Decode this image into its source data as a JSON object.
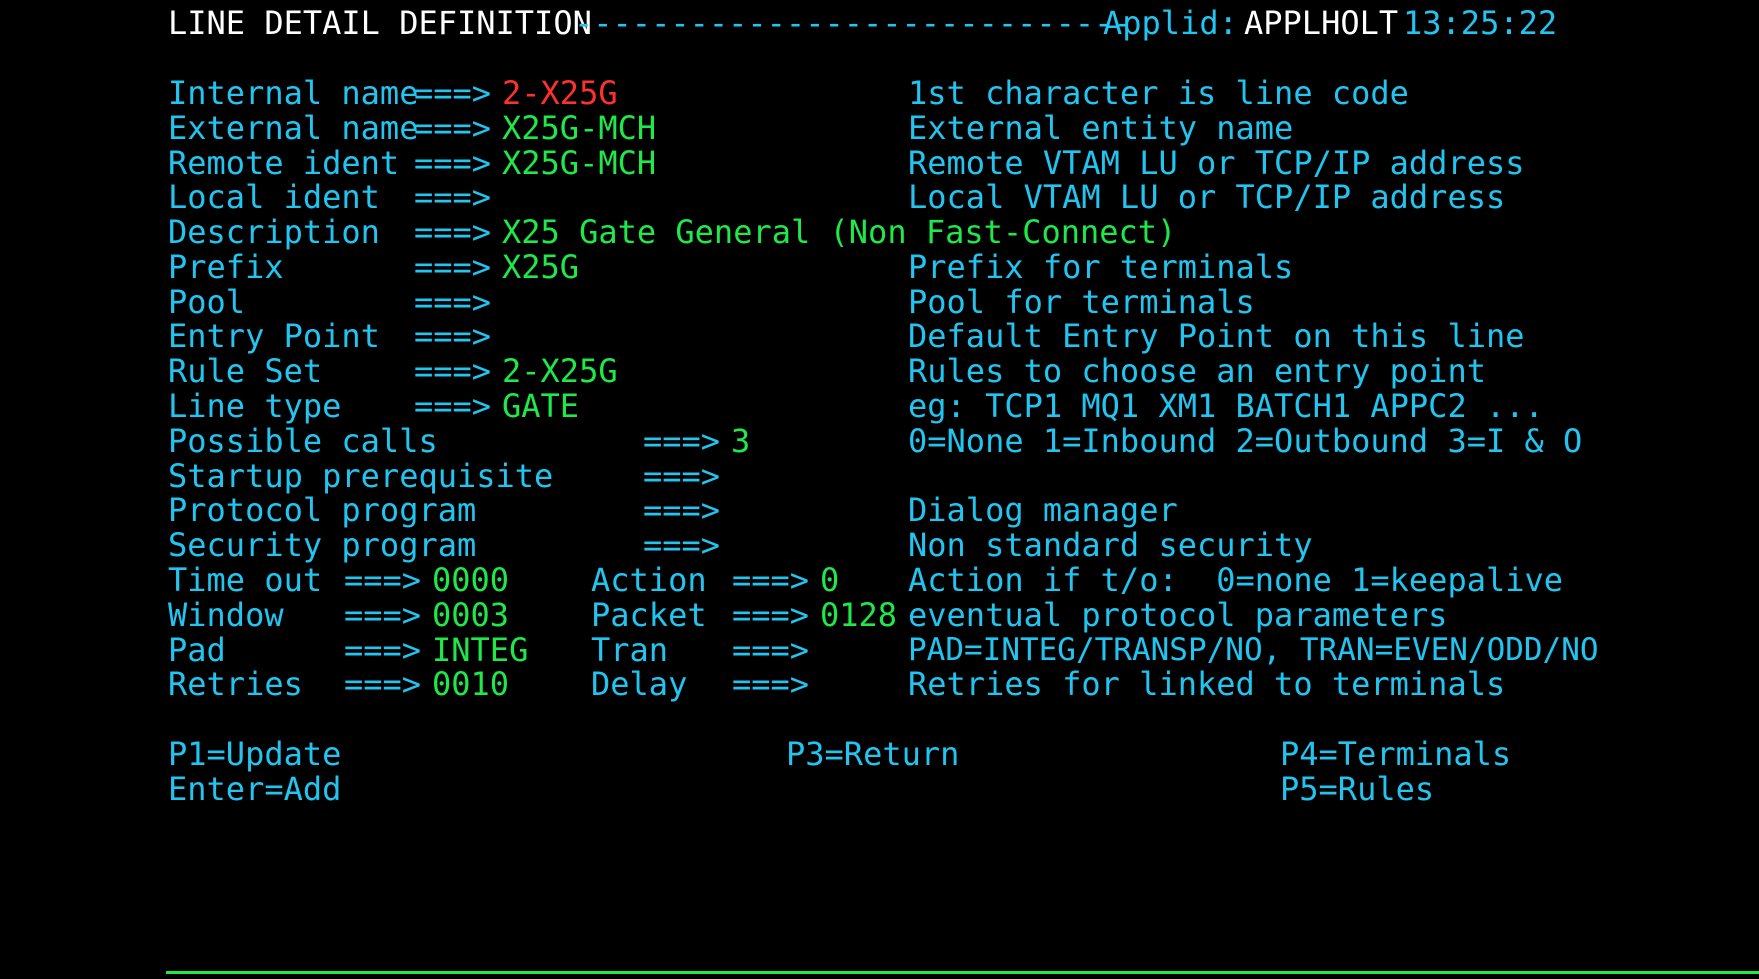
{
  "header": {
    "title": "LINE DETAIL DEFINITION",
    "dashes": "-----------------------------",
    "applid_label": "Applid:",
    "applid_value": "APPLHOLT",
    "time": "13:25:22"
  },
  "arrow": "===>",
  "fields": {
    "internal_name": {
      "label": "Internal name",
      "value": "2-X25G",
      "help": "1st character is line code"
    },
    "external_name": {
      "label": "External name",
      "value": "X25G-MCH",
      "help": "External entity name"
    },
    "remote_ident": {
      "label": "Remote ident",
      "value": "X25G-MCH",
      "help": "Remote VTAM LU or TCP/IP address"
    },
    "local_ident": {
      "label": "Local ident",
      "value": "",
      "help": "Local VTAM LU or TCP/IP address"
    },
    "description": {
      "label": "Description",
      "value": "X25 Gate General (Non Fast-Connect)"
    },
    "prefix": {
      "label": "Prefix",
      "value": "X25G",
      "help": "Prefix for terminals"
    },
    "pool": {
      "label": "Pool",
      "value": "",
      "help": "Pool for terminals"
    },
    "entry_point": {
      "label": "Entry Point",
      "value": "",
      "help": "Default Entry Point on this line"
    },
    "rule_set": {
      "label": "Rule Set",
      "value": "2-X25G",
      "help": "Rules to choose an entry point"
    },
    "line_type": {
      "label": "Line type",
      "value": "GATE",
      "help": "eg: TCP1 MQ1 XM1 BATCH1 APPC2 ..."
    },
    "possible_calls": {
      "label": "Possible calls",
      "value": "3",
      "help": "0=None 1=Inbound 2=Outbound 3=I & O"
    },
    "startup_prereq": {
      "label": "Startup prerequisite",
      "value": ""
    },
    "protocol_program": {
      "label": "Protocol program",
      "value": "",
      "help": "Dialog manager"
    },
    "security_program": {
      "label": "Security program",
      "value": "",
      "help": "Non standard security"
    },
    "time_out": {
      "label": "Time out",
      "value": "0000"
    },
    "action": {
      "label": "Action",
      "value": "0",
      "help": "Action if t/o:  0=none 1=keepalive"
    },
    "window": {
      "label": "Window",
      "value": "0003"
    },
    "packet": {
      "label": "Packet",
      "value": "0128",
      "help": "eventual protocol parameters"
    },
    "pad": {
      "label": "Pad",
      "value": "INTEG"
    },
    "tran": {
      "label": "Tran",
      "value": "",
      "help": "PAD=INTEG/TRANSP/NO, TRAN=EVEN/ODD/NO"
    },
    "retries": {
      "label": "Retries",
      "value": "0010"
    },
    "delay": {
      "label": "Delay",
      "value": "",
      "help": "Retries for linked to terminals"
    }
  },
  "pfkeys": {
    "p1": "P1=Update",
    "enter": "Enter=Add",
    "p3": "P3=Return",
    "p4": "P4=Terminals",
    "p5": "P5=Rules"
  },
  "colors": {
    "label": "#22C4F0",
    "value": "#1EE84A",
    "highlight": "#FF3030",
    "header_value": "#FFFFFF",
    "background": "#000000"
  }
}
